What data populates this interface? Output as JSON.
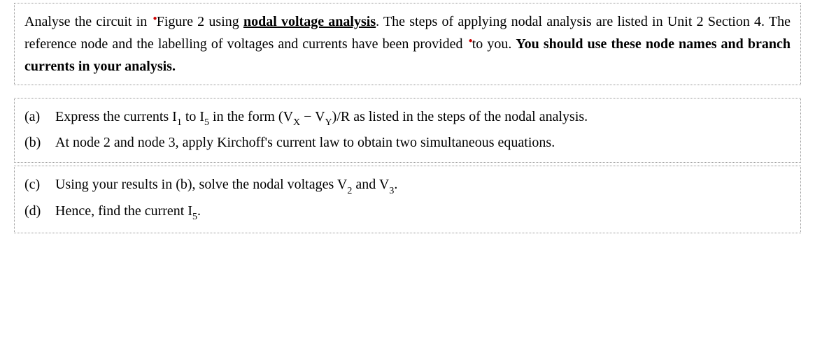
{
  "intro": {
    "pre": "Analyse the circuit in ",
    "fig": "Figure 2",
    "mid1": " using ",
    "method": "nodal voltage analysis",
    "mid2": ". The steps of applying nodal analysis are listed in Unit 2 Section 4. The reference node and the labelling of voltages and currents have been provided ",
    "to": "to",
    "mid3": " you. ",
    "bold_tail": "You should use these node names and branch currents in your analysis."
  },
  "items": [
    {
      "label": "(a)",
      "parts": {
        "p1": "Express the currents I",
        "s1": "1",
        "p2": " to I",
        "s2": "5",
        "p3": " in the form (V",
        "s3": "X",
        "p4": " − V",
        "s4": "Y",
        "p5": ")/R as listed in the steps of the nodal analysis."
      }
    },
    {
      "label": "(b)",
      "text": "At node 2 and node 3, apply Kirchoff's current law to obtain two simultaneous equations."
    },
    {
      "label": "(c)",
      "parts": {
        "p1": "Using your results in (b), solve the nodal voltages V",
        "s1": "2",
        "p2": " and V",
        "s2": "3",
        "p3": "."
      }
    },
    {
      "label": "(d)",
      "parts": {
        "p1": "Hence, find the current I",
        "s1": "5",
        "p2": "."
      }
    }
  ]
}
